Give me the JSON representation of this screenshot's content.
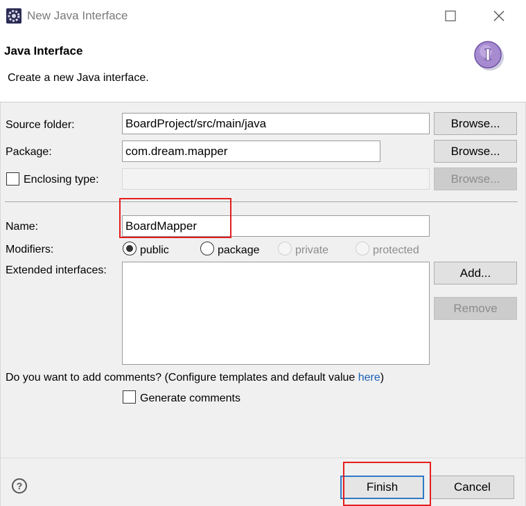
{
  "window": {
    "title": "New Java Interface",
    "icon": "gear-icon"
  },
  "banner": {
    "title": "Java Interface",
    "description": "Create a new Java interface.",
    "icon_letter": "I"
  },
  "form": {
    "source_folder": {
      "label": "Source folder:",
      "value": "BoardProject/src/main/java",
      "browse": "Browse..."
    },
    "package": {
      "label": "Package:",
      "value": "com.dream.mapper",
      "browse": "Browse..."
    },
    "enclosing_type": {
      "label": "Enclosing type:",
      "value": "",
      "browse": "Browse..."
    },
    "name": {
      "label": "Name:",
      "value": "BoardMapper"
    },
    "modifiers": {
      "label": "Modifiers:",
      "options": [
        "public",
        "package",
        "private",
        "protected"
      ],
      "selected": "public"
    },
    "extended_interfaces": {
      "label": "Extended interfaces:",
      "add": "Add...",
      "remove": "Remove"
    },
    "comments": {
      "question": "Do you want to add comments? (Configure templates and default value ",
      "link": "here",
      "close": ")",
      "generate": "Generate comments"
    }
  },
  "footer": {
    "help": "?",
    "finish": "Finish",
    "cancel": "Cancel"
  },
  "colors": {
    "highlight": "#e51c1c",
    "link": "#1a5fb4",
    "primary_border": "#2f79c6"
  }
}
